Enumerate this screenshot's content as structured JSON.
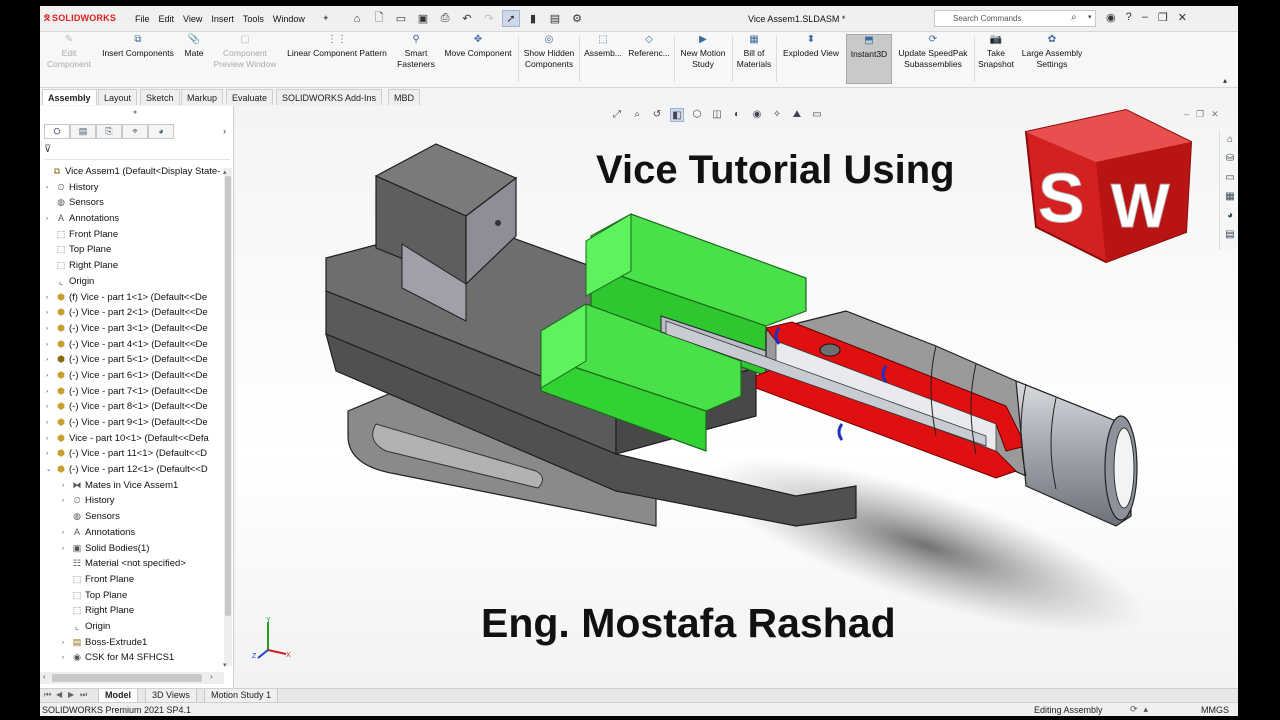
{
  "app": {
    "logo": "SOLIDWORKS",
    "doc_title": "Vice Assem1.SLDASM *",
    "menus": [
      "File",
      "Edit",
      "View",
      "Insert",
      "Tools",
      "Window"
    ],
    "search_placeholder": "Search Commands"
  },
  "ribbon": [
    {
      "label": "Edit Component",
      "icon": "edit-component-icon",
      "disabled": true
    },
    {
      "label": "Insert Components",
      "icon": "insert-components-icon"
    },
    {
      "label": "Mate",
      "icon": "mate-icon"
    },
    {
      "label": "Component Preview Window",
      "icon": "preview-window-icon",
      "disabled": true
    },
    {
      "label": "Linear Component Pattern",
      "icon": "linear-pattern-icon"
    },
    {
      "label": "Smart Fasteners",
      "icon": "smart-fasteners-icon"
    },
    {
      "label": "Move Component",
      "icon": "move-component-icon"
    },
    {
      "label": "Show Hidden Components",
      "icon": "show-hidden-icon"
    },
    {
      "label": "Assemb...",
      "icon": "assembly-features-icon"
    },
    {
      "label": "Referenc...",
      "icon": "reference-geometry-icon"
    },
    {
      "label": "New Motion Study",
      "icon": "motion-study-icon"
    },
    {
      "label": "Bill of Materials",
      "icon": "bom-icon"
    },
    {
      "label": "Exploded View",
      "icon": "exploded-view-icon"
    },
    {
      "label": "Instant3D",
      "icon": "instant3d-icon",
      "active": true
    },
    {
      "label": "Update SpeedPak Subassemblies",
      "icon": "speedpak-icon"
    },
    {
      "label": "Take Snapshot",
      "icon": "snapshot-icon"
    },
    {
      "label": "Large Assembly Settings",
      "icon": "large-assembly-icon"
    }
  ],
  "command_tabs": [
    "Assembly",
    "Layout",
    "Sketch",
    "Markup",
    "Evaluate",
    "SOLIDWORKS Add-Ins",
    "MBD"
  ],
  "active_tab": "Assembly",
  "tree": [
    {
      "label": "Vice Assem1  (Default<Display State-",
      "depth": 0,
      "icon": "assembly-icon",
      "exp": "",
      "icolor": "#8a6a10"
    },
    {
      "label": "History",
      "depth": 1,
      "icon": "history-icon",
      "exp": "›",
      "icolor": "#555"
    },
    {
      "label": "Sensors",
      "depth": 1,
      "icon": "sensors-icon",
      "exp": "",
      "icolor": "#555"
    },
    {
      "label": "Annotations",
      "depth": 1,
      "icon": "annotations-icon",
      "exp": "›",
      "icolor": "#555"
    },
    {
      "label": "Front Plane",
      "depth": 1,
      "icon": "plane-icon",
      "exp": "",
      "icolor": "#555"
    },
    {
      "label": "Top Plane",
      "depth": 1,
      "icon": "plane-icon",
      "exp": "",
      "icolor": "#555"
    },
    {
      "label": "Right Plane",
      "depth": 1,
      "icon": "plane-icon",
      "exp": "",
      "icolor": "#555"
    },
    {
      "label": "Origin",
      "depth": 1,
      "icon": "origin-icon",
      "exp": "",
      "icolor": "#555"
    },
    {
      "label": "(f) Vice - part 1<1> (Default<<De",
      "depth": 1,
      "icon": "part-icon",
      "exp": "›",
      "icolor": "#c9a030"
    },
    {
      "label": "(-) Vice - part 2<1> (Default<<De",
      "depth": 1,
      "icon": "part-icon",
      "exp": "›",
      "icolor": "#c9a030"
    },
    {
      "label": "(-) Vice - part 3<1> (Default<<De",
      "depth": 1,
      "icon": "part-icon",
      "exp": "›",
      "icolor": "#c9a030"
    },
    {
      "label": "(-) Vice - part 4<1> (Default<<De",
      "depth": 1,
      "icon": "part-icon",
      "exp": "›",
      "icolor": "#c9a030"
    },
    {
      "label": "(-) Vice - part 5<1> (Default<<De",
      "depth": 1,
      "icon": "part-icon",
      "exp": "›",
      "icolor": "#8a6a10"
    },
    {
      "label": "(-) Vice - part 6<1> (Default<<De",
      "depth": 1,
      "icon": "part-icon",
      "exp": "›",
      "icolor": "#c9a030"
    },
    {
      "label": "(-) Vice - part 7<1> (Default<<De",
      "depth": 1,
      "icon": "part-icon",
      "exp": "›",
      "icolor": "#c9a030"
    },
    {
      "label": "(-) Vice - part 8<1> (Default<<De",
      "depth": 1,
      "icon": "part-icon",
      "exp": "›",
      "icolor": "#c9a030"
    },
    {
      "label": "(-) Vice - part 9<1> (Default<<De",
      "depth": 1,
      "icon": "part-icon",
      "exp": "›",
      "icolor": "#c9a030"
    },
    {
      "label": "Vice - part 10<1> (Default<<Defa",
      "depth": 1,
      "icon": "part-icon",
      "exp": "›",
      "icolor": "#c9a030"
    },
    {
      "label": "(-) Vice - part 11<1> (Default<<D",
      "depth": 1,
      "icon": "part-icon",
      "exp": "›",
      "icolor": "#c9a030"
    },
    {
      "label": "(-) Vice - part 12<1> (Default<<D",
      "depth": 1,
      "icon": "part-icon",
      "exp": "⌄",
      "icolor": "#c9a030"
    },
    {
      "label": "Mates in Vice Assem1",
      "depth": 2,
      "icon": "mates-icon",
      "exp": "›",
      "icolor": "#555"
    },
    {
      "label": "History",
      "depth": 2,
      "icon": "history-icon",
      "exp": "›",
      "icolor": "#555"
    },
    {
      "label": "Sensors",
      "depth": 2,
      "icon": "sensors-icon",
      "exp": "",
      "icolor": "#555"
    },
    {
      "label": "Annotations",
      "depth": 2,
      "icon": "annotations-icon",
      "exp": "›",
      "icolor": "#555"
    },
    {
      "label": "Solid Bodies(1)",
      "depth": 2,
      "icon": "solid-bodies-icon",
      "exp": "›",
      "icolor": "#555"
    },
    {
      "label": "Material <not specified>",
      "depth": 2,
      "icon": "material-icon",
      "exp": "",
      "icolor": "#555"
    },
    {
      "label": "Front Plane",
      "depth": 2,
      "icon": "plane-icon",
      "exp": "",
      "icolor": "#555"
    },
    {
      "label": "Top Plane",
      "depth": 2,
      "icon": "plane-icon",
      "exp": "",
      "icolor": "#555"
    },
    {
      "label": "Right Plane",
      "depth": 2,
      "icon": "plane-icon",
      "exp": "",
      "icolor": "#555"
    },
    {
      "label": "Origin",
      "depth": 2,
      "icon": "origin-icon",
      "exp": "",
      "icolor": "#555"
    },
    {
      "label": "Boss-Extrude1",
      "depth": 2,
      "icon": "extrude-icon",
      "exp": "›",
      "icolor": "#8a6a10"
    },
    {
      "label": "CSK for M4 SFHCS1",
      "depth": 2,
      "icon": "hole-icon",
      "exp": "›",
      "icolor": "#555"
    }
  ],
  "viewport": {
    "title": "Vice Tutorial Using",
    "author": "Eng. Mostafa Rashad",
    "logo_letters": [
      "S",
      "W"
    ],
    "colors": {
      "jaw_green": "#3fe23f",
      "section_red": "#e01010",
      "body_grey": "#5e5e5e",
      "logo_red": "#d42020"
    }
  },
  "bottom_tabs": [
    "Model",
    "3D Views",
    "Motion Study 1"
  ],
  "active_bottom_tab": "Model",
  "status": {
    "version": "SOLIDWORKS Premium 2021 SP4.1",
    "mode": "Editing Assembly",
    "units": "MMGS"
  }
}
